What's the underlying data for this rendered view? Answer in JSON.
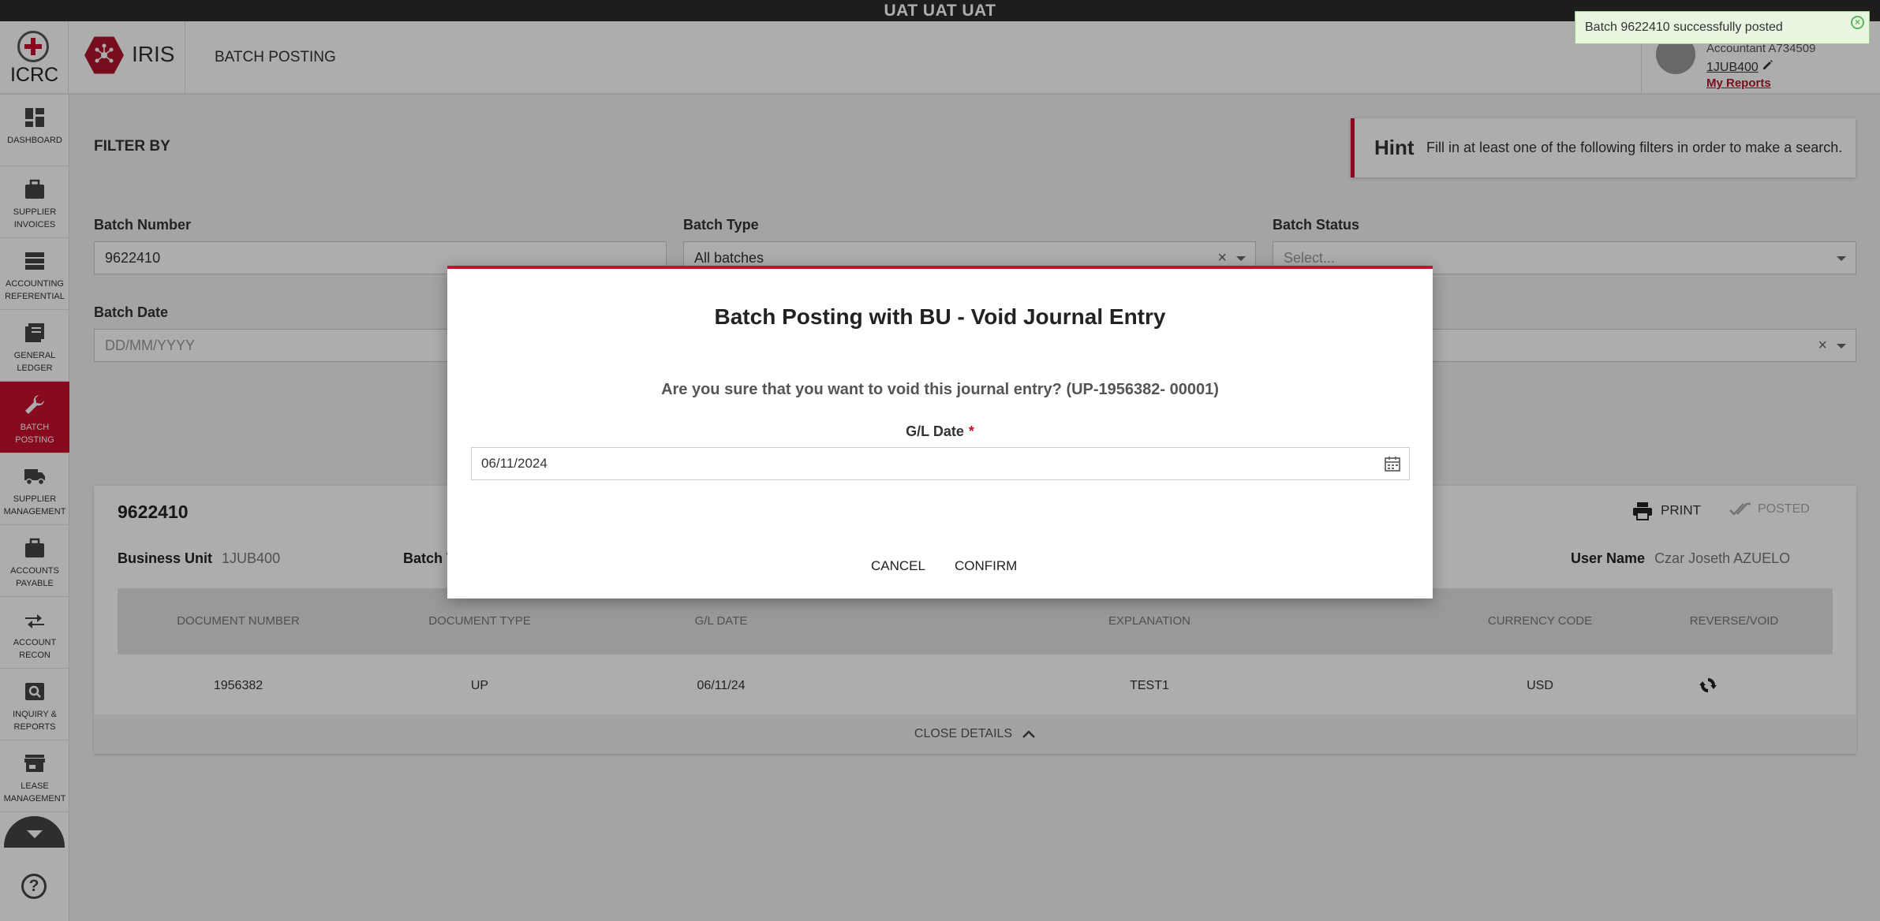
{
  "env_banner": "UAT UAT UAT",
  "header": {
    "org": "ICRC",
    "app": "IRIS",
    "page_title": "BATCH POSTING"
  },
  "user": {
    "role": "Accountant A734509",
    "business_unit": "1JUB400",
    "my_reports": "My Reports"
  },
  "toast": {
    "message": "Batch 9622410 successfully posted",
    "close_icon": "×"
  },
  "sidebar": {
    "items": [
      {
        "label": "Dashboard",
        "icon": "dashboard-icon"
      },
      {
        "label": "Supplier Invoices",
        "icon": "briefcase-icon"
      },
      {
        "label": "Accounting Referential",
        "icon": "list-icon"
      },
      {
        "label": "General Ledger",
        "icon": "ledger-icon"
      },
      {
        "label": "Batch Posting",
        "icon": "wrench-icon"
      },
      {
        "label": "Supplier Management",
        "icon": "truck-icon"
      },
      {
        "label": "Accounts Payable",
        "icon": "briefcase-icon"
      },
      {
        "label": "Account Recon",
        "icon": "arrows-icon"
      },
      {
        "label": "Inquiry & Reports",
        "icon": "search-icon"
      },
      {
        "label": "Lease Management",
        "icon": "store-icon"
      }
    ],
    "help": "?"
  },
  "filters": {
    "title": "FILTER BY",
    "hint_title": "Hint",
    "hint_text": "Fill in at least one of the following filters in order to make a search.",
    "batch_number_label": "Batch Number",
    "batch_number_value": "9622410",
    "batch_type_label": "Batch Type",
    "batch_type_value": "All batches",
    "batch_status_label": "Batch Status",
    "batch_status_placeholder": "Select...",
    "batch_date_label": "Batch Date",
    "batch_date_placeholder": "DD/MM/YYYY",
    "clear_symbol": "×"
  },
  "result": {
    "batch_number": "9622410",
    "print_label": "PRINT",
    "posted_label": "POSTED",
    "business_unit_label": "Business Unit",
    "business_unit_value": "1JUB400",
    "batch_type_label_partial": "Batch T",
    "user_name_label": "User Name",
    "user_name_value": "Czar Joseth AZUELO",
    "columns": [
      "Document Number",
      "Document Type",
      "G/L Date",
      "Explanation",
      "Currency Code",
      "Reverse/Void"
    ],
    "rows": [
      {
        "document_number": "1956382",
        "document_type": "UP",
        "gl_date": "06/11/24",
        "explanation": "TEST1",
        "currency_code": "USD"
      }
    ],
    "close_details": "CLOSE DETAILS"
  },
  "modal": {
    "title": "Batch Posting with BU - Void Journal Entry",
    "question": "Are you sure that you want to void this journal entry? (UP-1956382- 00001)",
    "gl_date_label": "G/L Date",
    "required_mark": "*",
    "gl_date_value": "06/11/2024",
    "cancel_label": "CANCEL",
    "confirm_label": "CONFIRM"
  },
  "colors": {
    "brand_red": "#c8102e",
    "toast_bg": "#e8f5e0"
  }
}
